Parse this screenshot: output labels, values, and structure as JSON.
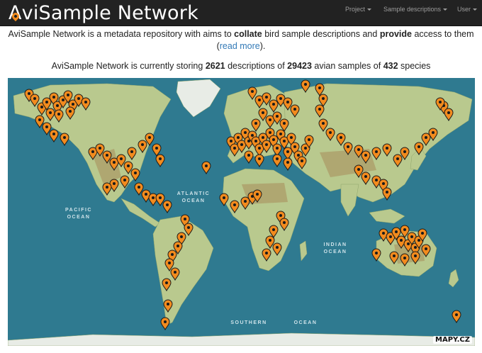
{
  "navbar": {
    "brand": "AviSample Network",
    "menu": [
      {
        "label": "Project"
      },
      {
        "label": "Sample descriptions"
      },
      {
        "label": "User"
      }
    ]
  },
  "intro": {
    "t1": "AviSample Network is a metadata repository with aims to ",
    "b1": "collate",
    "t2": " bird sample descriptions and ",
    "b2": "provide",
    "t3": " access to them",
    "open_paren": "(",
    "link": "read more",
    "close_paren": ")."
  },
  "stats": {
    "prefix": "AviSample Network is currently storing ",
    "descriptions": "2621",
    "mid1": " descriptions of ",
    "samples": "29423",
    "mid2": " avian samples of ",
    "species": "432",
    "suffix": " species"
  },
  "map": {
    "ocean_labels": [
      "ATLANTIC",
      "OCEAN",
      "PACIFIC",
      "OCEAN",
      "INDIAN",
      "OCEAN",
      "SOUTHERN",
      "OCEAN"
    ],
    "attribution": "MAPY.CZ",
    "marker_color": "#f28b1e",
    "ocean_color": "#2f7a90",
    "land_color": "#b9c98e",
    "ice_color": "#e8ece6"
  }
}
